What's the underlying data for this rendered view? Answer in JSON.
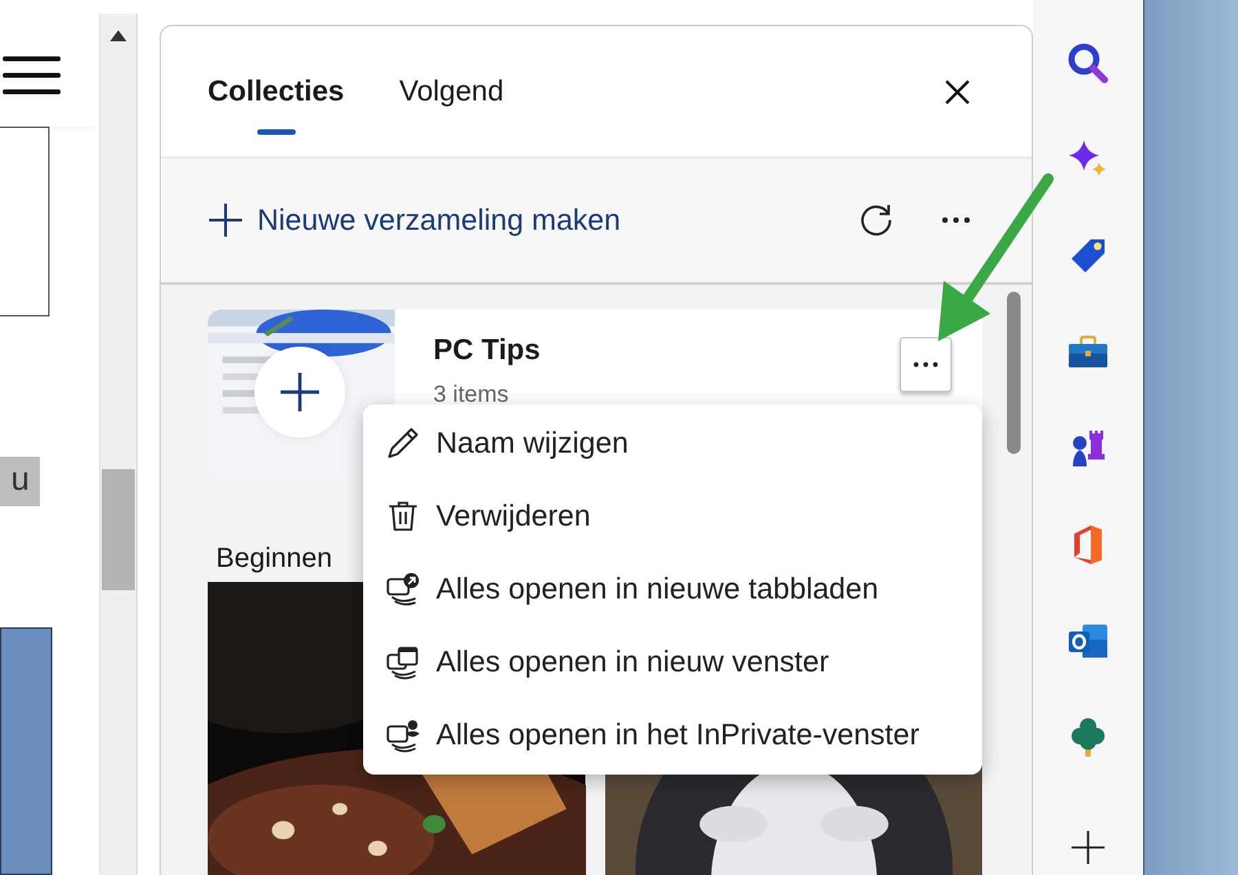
{
  "page": {
    "tag": "u"
  },
  "panel": {
    "tabs": [
      {
        "label": "Collecties",
        "selected": true
      },
      {
        "label": "Volgend",
        "selected": false
      }
    ],
    "new_collection": "Nieuwe verzameling maken",
    "collections": [
      {
        "kind": "compact",
        "title": "PC Tips",
        "count": "3 items",
        "menu_open": true
      },
      {
        "kind": "gallery",
        "title": "Beginnen"
      }
    ],
    "menu": [
      {
        "kind": "rename",
        "label": "Naam wijzigen"
      },
      {
        "kind": "delete",
        "label": "Verwijderen"
      },
      {
        "kind": "open-tabs",
        "label": "Alles openen in nieuwe tabbladen"
      },
      {
        "kind": "open-window",
        "label": "Alles openen in nieuw venster"
      },
      {
        "kind": "open-private",
        "label": "Alles openen in het InPrivate-venster"
      }
    ]
  }
}
